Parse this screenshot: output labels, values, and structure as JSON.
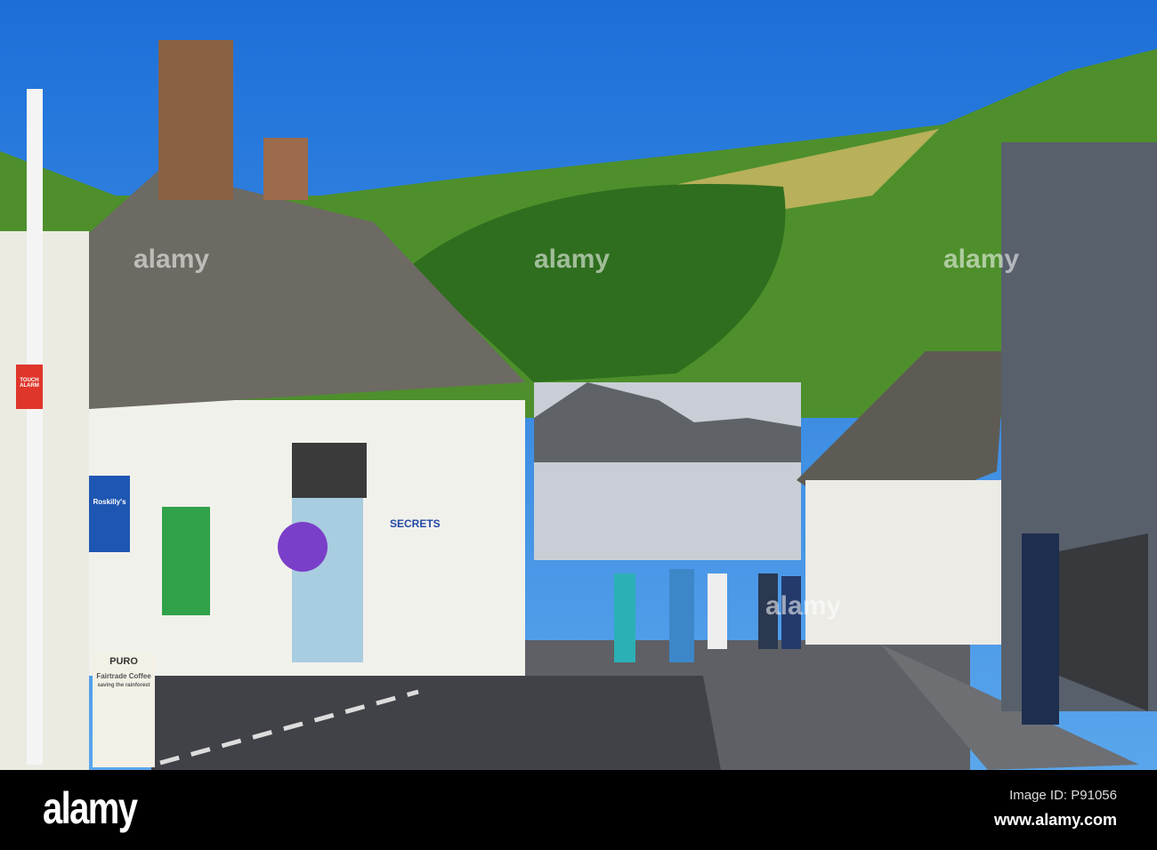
{
  "watermark": {
    "brand": "alamy",
    "image_id_label": "Image ID: P91056",
    "website": "www.alamy.com"
  },
  "signs": {
    "gallery": "SECRETS",
    "coffee_brand": "PURO",
    "coffee_line1": "Fairtrade Coffee",
    "coffee_line2": "saving the rainforest",
    "ice_cream": "Roskilly's",
    "alarm": "TOUCH ALARM"
  },
  "colors": {
    "sky": "#1f7fe0",
    "hill": "#3f8a2a",
    "roof": "#6f6d66",
    "wall": "#f2f2ee",
    "road": "#5d5f63"
  }
}
